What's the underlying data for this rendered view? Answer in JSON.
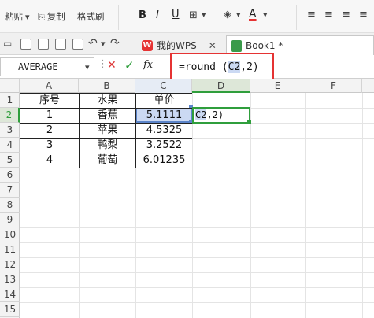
{
  "ribbon": {
    "paste": "粘贴",
    "copy": "复制",
    "format_painter": "格式刷"
  },
  "tabs": [
    {
      "label": "我的WPS"
    },
    {
      "label": "Book1 *"
    }
  ],
  "name_box": {
    "value": "AVERAGE"
  },
  "formula": {
    "prefix": "=round (",
    "ref": "C2",
    "suffix": ",2)"
  },
  "columns": [
    "A",
    "B",
    "C",
    "D",
    "E",
    "F"
  ],
  "rows": [
    "1",
    "2",
    "3",
    "4",
    "5",
    "6",
    "7",
    "8",
    "9",
    "10",
    "11",
    "12",
    "13",
    "14",
    "15"
  ],
  "sheet": {
    "header": [
      "序号",
      "水果",
      "单价"
    ],
    "rows": [
      {
        "no": "1",
        "fruit": "香蕉",
        "price": "5.1111"
      },
      {
        "no": "2",
        "fruit": "苹果",
        "price": "4.5325"
      },
      {
        "no": "3",
        "fruit": "鸭梨",
        "price": "3.2522"
      },
      {
        "no": "4",
        "fruit": "葡萄",
        "price": "6.01235"
      }
    ],
    "editing_cell_text": {
      "ref": "C2",
      "suffix": ",2)"
    }
  },
  "colors": {
    "accent_red": "#e53333",
    "active_green": "#2f9e3c",
    "ref_highlight": "#cbd9f3"
  }
}
